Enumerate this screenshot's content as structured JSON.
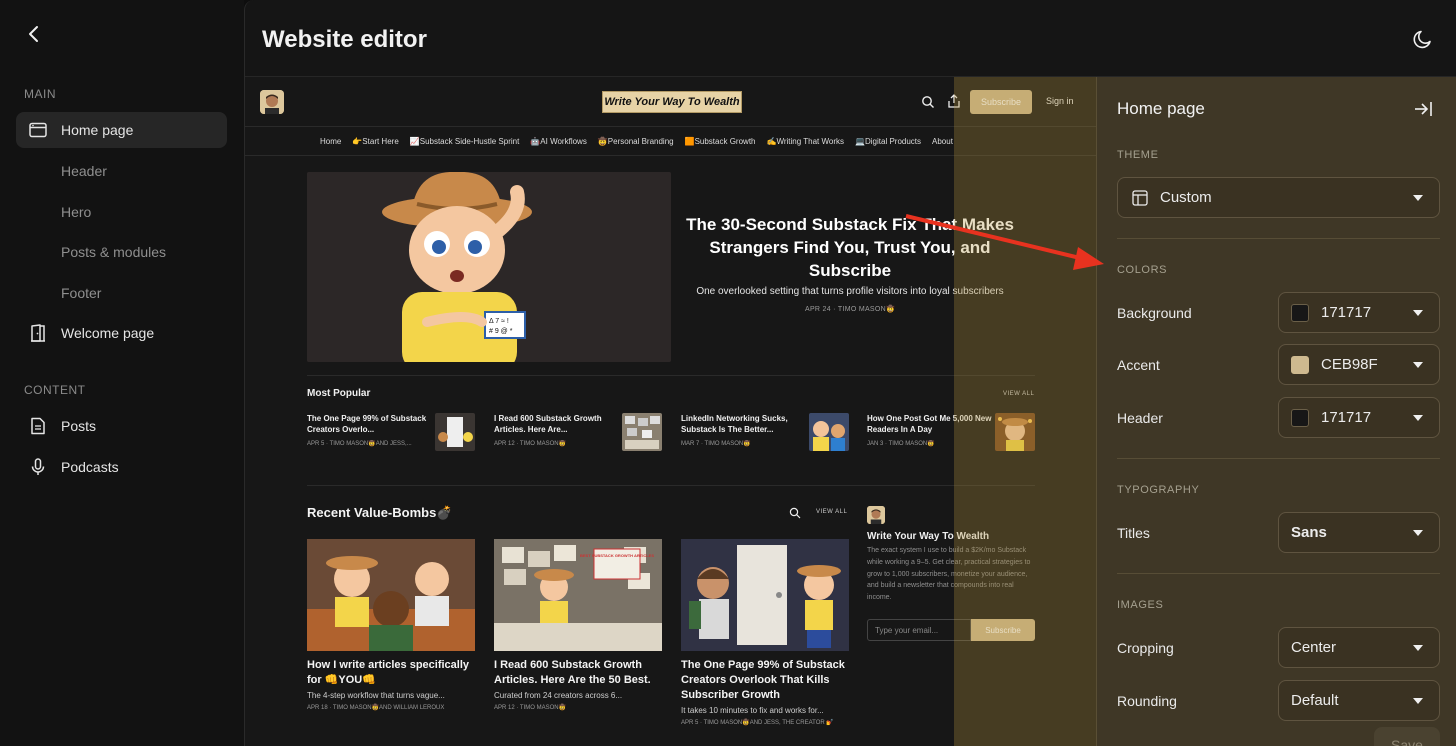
{
  "sidebar": {
    "sections": {
      "main": "MAIN",
      "content": "CONTENT"
    },
    "items": {
      "home": "Home page",
      "header": "Header",
      "hero": "Hero",
      "posts_modules": "Posts & modules",
      "footer": "Footer",
      "welcome": "Welcome page",
      "posts": "Posts",
      "podcasts": "Podcasts"
    }
  },
  "header": {
    "title": "Website editor"
  },
  "preview": {
    "logo_text": "Write Your Way To Wealth",
    "subscribe": "Subscribe",
    "signin": "Sign in",
    "nav": [
      "Home",
      "👉Start Here",
      "📈Substack Side-Hustle Sprint",
      "🤖AI Workflows",
      "🤠Personal Branding",
      "🟧Substack Growth",
      "✍️Writing That Works",
      "💻Digital Products",
      "About"
    ],
    "hero": {
      "title": "The 30-Second Substack Fix That Makes Strangers Find You, Trust You, and Subscribe",
      "subtitle": "One overlooked setting that turns profile visitors into loyal subscribers",
      "meta": "APR 24 · TIMO MASON🤠",
      "badge_line1": "Δ 7 ≈ !",
      "badge_line2": "# 9 @ *"
    },
    "most_popular": {
      "title": "Most Popular",
      "view_all": "VIEW ALL",
      "items": [
        {
          "title": "The One Page 99% of Substack Creators Overlo...",
          "meta": "APR 5 · TIMO MASON🤠AND JESS,..."
        },
        {
          "title": "I Read 600 Substack Growth Articles. Here Are...",
          "meta": "APR 12 · TIMO MASON🤠"
        },
        {
          "title": "LinkedIn Networking Sucks, Substack Is The Better...",
          "meta": "MAR 7 · TIMO MASON🤠"
        },
        {
          "title": "How One Post Got Me 5,000 New Readers In A Day",
          "meta": "JAN 3 · TIMO MASON🤠"
        }
      ]
    },
    "recent": {
      "title": "Recent Value-Bombs💣",
      "view_all": "VIEW ALL",
      "items": [
        {
          "title": "How I write articles specifically for 👊YOU👊",
          "desc": "The 4-step workflow that turns vague...",
          "meta": "APR 18 · TIMO MASON🤠AND WILLIAM LEROUX"
        },
        {
          "title": "I Read 600 Substack Growth Articles. Here Are the 50 Best.",
          "desc": "Curated from 24 creators across 6...",
          "meta": "APR 12 · TIMO MASON🤠"
        },
        {
          "title": "The One Page 99% of Substack Creators Overlook That Kills Subscriber Growth",
          "desc": "It takes 10 minutes to fix and works for...",
          "meta": "APR 5 · TIMO MASON🤠AND JESS, THE CREATOR 💅"
        }
      ],
      "img2_sign": "BEST SUBSTACK GROWTH ARTICLES"
    },
    "aside": {
      "title": "Write Your Way To Wealth",
      "desc": "The exact system I use to build a $2K/mo Substack while working a 9–5. Get clear, practical strategies to grow to 1,000 subscribers, monetize your audience, and build a newsletter that compounds into real income.",
      "input_placeholder": "Type your email...",
      "subscribe": "Subscribe"
    }
  },
  "panel": {
    "title": "Home page",
    "theme": {
      "label": "THEME",
      "value": "Custom"
    },
    "colors": {
      "label": "COLORS",
      "background": {
        "label": "Background",
        "value": "171717",
        "hex": "#171717"
      },
      "accent": {
        "label": "Accent",
        "value": "CEB98F",
        "hex": "#CEB98F"
      },
      "header": {
        "label": "Header",
        "value": "171717",
        "hex": "#171717"
      }
    },
    "typography": {
      "label": "TYPOGRAPHY",
      "titles_label": "Titles",
      "titles_value": "Sans"
    },
    "images": {
      "label": "IMAGES",
      "cropping_label": "Cropping",
      "cropping_value": "Center",
      "rounding_label": "Rounding",
      "rounding_value": "Default"
    },
    "save": "Save"
  },
  "colors": {
    "accent": "#ceb98f",
    "panel_bg": "#3f3726",
    "annotation_arrow": "#e8321f"
  }
}
